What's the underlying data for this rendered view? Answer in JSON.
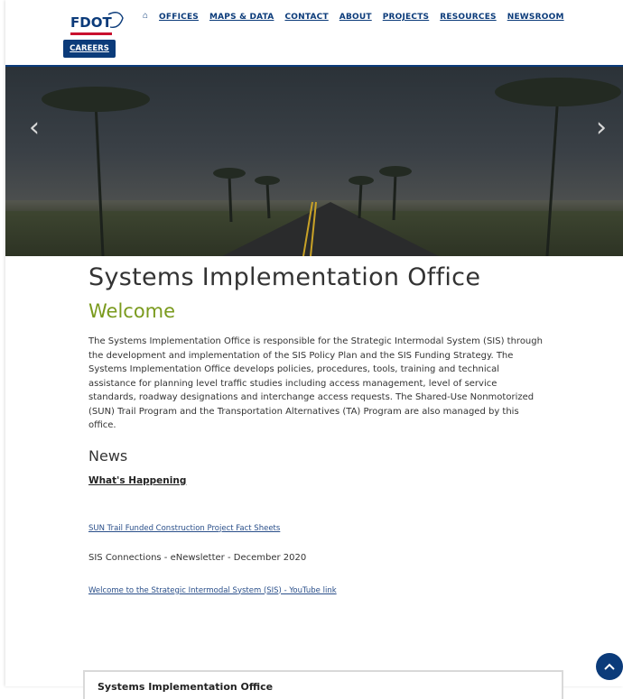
{
  "header": {
    "logo_text": "FDOT",
    "nav": [
      "OFFICES",
      "MAPS & DATA",
      "CONTACT",
      "ABOUT",
      "PROJECTS",
      "RESOURCES",
      "NEWSROOM"
    ],
    "careers_label": "CAREERS"
  },
  "hero": {
    "prev_label": "‹",
    "next_label": "›"
  },
  "main": {
    "title": "Systems Implementation Office",
    "welcome": "Welcome",
    "intro": "The Systems Implementation Office is responsible for the Strategic Intermodal System (SIS) through the development and implementation of the SIS Policy Plan and the SIS Funding Strategy. The Systems Implementation Office develops policies, procedures, tools, training and technical assistance for planning level traffic studies including access management, level of service standards, roadway designations and interchange access requests. The Shared-Use Nonmotorized (SUN) Trail Program and the Transportation Alternatives (TA) Program are also managed by this office.",
    "news_heading": "News",
    "whats_happening": "What's Happening",
    "news_items": [
      "SUN Trail Funded Construction Project Fact Sheets",
      "SIS Connections - eNewsletter - December 2020",
      "Welcome to the Strategic Intermodal System (SIS) - YouTube link"
    ],
    "box_title": "Systems Implementation Office"
  },
  "colors": {
    "brand_blue": "#0b3b7a",
    "welcome_green": "#7a9a1d",
    "link_blue": "#2a4f8a"
  }
}
